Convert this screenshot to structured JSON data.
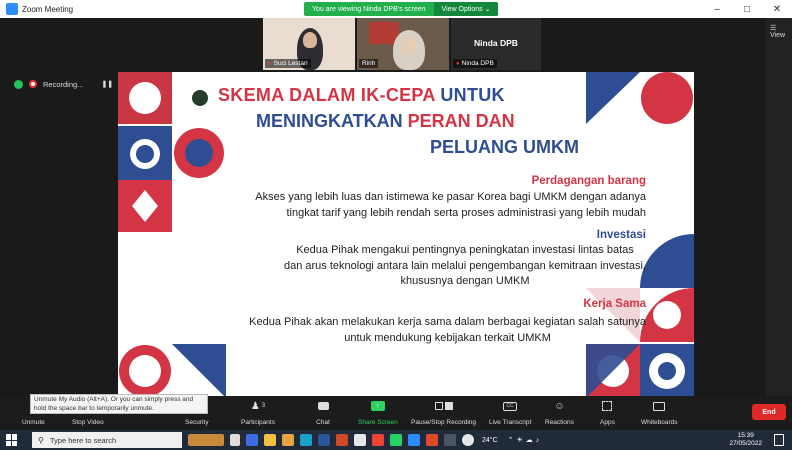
{
  "window": {
    "title": "Zoom Meeting",
    "minimize": "–",
    "maximize": "□",
    "close": "✕"
  },
  "banner": {
    "message": "You are viewing Ninda DPB's screen",
    "view_options": "View Options ⌄"
  },
  "right_panel": {
    "view_label": "☰ View"
  },
  "participants": [
    {
      "name": "Suci Lestari",
      "muted": true
    },
    {
      "name": "Ririh",
      "muted": false
    },
    {
      "name": "Ninda DPB",
      "muted": true,
      "display_name": "Ninda DPB"
    }
  ],
  "recording": {
    "label": "Recording...",
    "pause_icon": "❚❚",
    "stop_icon": "■"
  },
  "slide": {
    "title_line1_red": "SKEMA DALAM IK-CEPA",
    "title_line1_blue": "UNTUK",
    "title_line2_blue": "MENINGKATKAN",
    "title_line2_red": "PERAN DAN",
    "title_line3": "PELUANG UMKM",
    "sections": [
      {
        "heading": "Perdagangan barang",
        "lines": [
          "Akses yang lebih luas dan istimewa ke pasar Korea bagi UMKM dengan adanya",
          "tingkat tarif yang lebih rendah serta proses administrasi yang lebih mudah"
        ]
      },
      {
        "heading": "Investasi",
        "lines": [
          "Kedua Pihak mengakui pentingnya peningkatan investasi lintas batas",
          "dan arus teknologi antara lain melalui pengembangan kemitraan investasi,",
          "khususnya dengan UMKM"
        ]
      },
      {
        "heading": "Kerja Sama",
        "lines": [
          "Kedua Pihak akan melakukan kerja sama dalam berbagai kegiatan salah satunya",
          "untuk mendukung kebijakan terkait UMKM"
        ]
      }
    ]
  },
  "tooltip": "Unmute My Audio (Alt+A). Or you can simply press and hold the space bar to temporarily unmute.",
  "toolbar": {
    "unmute": "Unmute",
    "stop_video": "Stop Video",
    "security": "Security",
    "participants": "Participants",
    "participants_count": "3",
    "chat": "Chat",
    "share_screen": "Share Screen",
    "pause_recording": "Pause/Stop Recording",
    "live_transcript": "Live Transcript",
    "reactions": "Reactions",
    "apps": "Apps",
    "whiteboards": "Whiteboards",
    "end": "End",
    "cc_icon": "CC"
  },
  "taskbar": {
    "search_placeholder": "Type here to search",
    "temperature": "24°C",
    "time": "15:39",
    "date": "27/05/2022"
  },
  "colors": {
    "accent_red": "#d43545",
    "accent_blue": "#2f4d92",
    "zoom_green": "#21b04b",
    "end_red": "#e02828"
  }
}
